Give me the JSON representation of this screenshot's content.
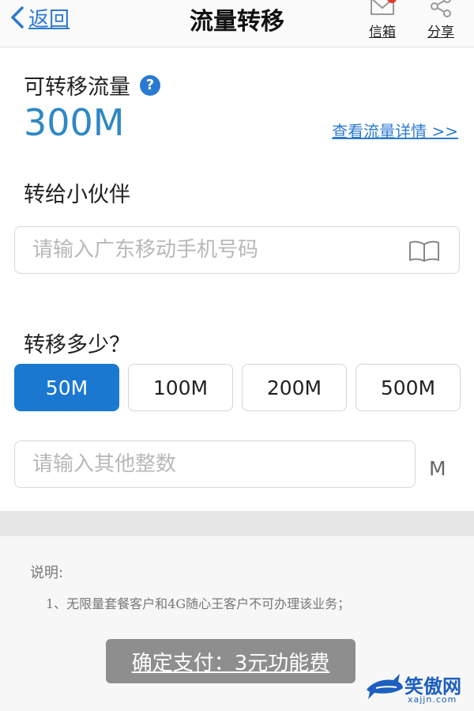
{
  "nav": {
    "back_label": "返回",
    "title": "流量转移",
    "mailbox_label": "信箱",
    "share_label": "分享"
  },
  "available": {
    "label": "可转移流量",
    "help_icon": "?",
    "value": "300M",
    "detail_link": "查看流量详情 >>"
  },
  "recipient": {
    "label": "转给小伙伴",
    "placeholder": "请输入广东移动手机号码"
  },
  "amount": {
    "label": "转移多少？",
    "options": [
      "50M",
      "100M",
      "200M",
      "500M"
    ],
    "selected": "50M",
    "custom_placeholder": "请输入其他整数",
    "unit": "M"
  },
  "notes": {
    "title": "说明:",
    "items": [
      "1、无限量套餐客户和4G随心王客户不可办理该业务；"
    ]
  },
  "pay_button": "确定支付：3元功能费",
  "watermark": {
    "text": "笑傲网",
    "sub": "xajjn.com"
  },
  "colors": {
    "accent": "#1b78d0",
    "link": "#2b7ad1",
    "value": "#2e88c4",
    "badge": "#e8382f",
    "pay_button": "#8e8e8e"
  }
}
